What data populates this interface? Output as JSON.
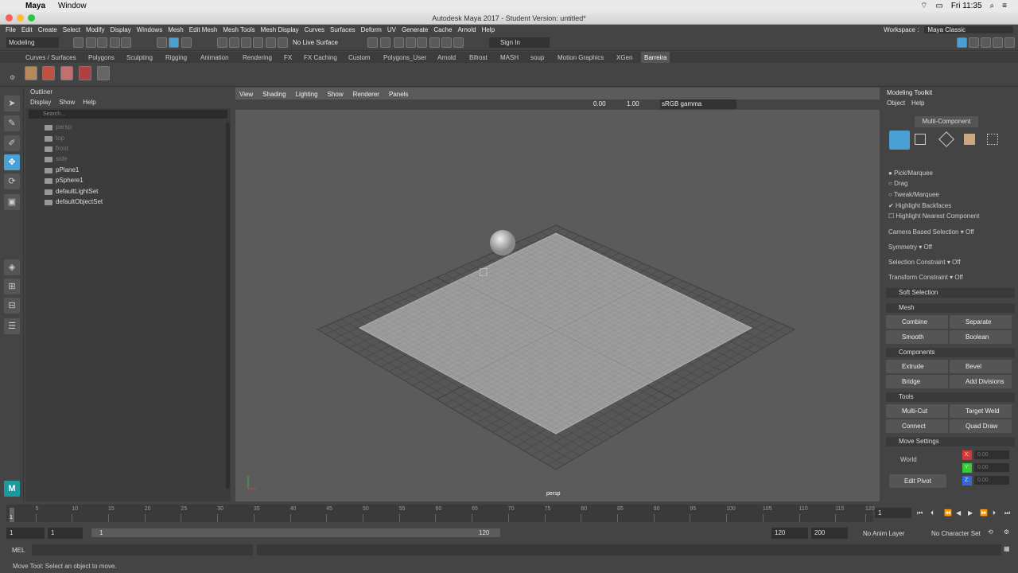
{
  "mac": {
    "apple": "",
    "app": "Maya",
    "window": "Window",
    "time": "Fri 11:35"
  },
  "title": "Autodesk Maya 2017 - Student Version: untitled*",
  "menus": [
    "File",
    "Edit",
    "Create",
    "Select",
    "Modify",
    "Display",
    "Windows",
    "Mesh",
    "Edit Mesh",
    "Mesh Tools",
    "Mesh Display",
    "Curves",
    "Surfaces",
    "Deform",
    "UV",
    "Generate",
    "Cache",
    "Arnold",
    "Help"
  ],
  "workspace": {
    "label": "Workspace :",
    "value": "Maya Classic"
  },
  "status": {
    "mode": "Modeling",
    "live": "No Live Surface",
    "signin": "Sign In"
  },
  "shelf_tabs": [
    "Curves / Surfaces",
    "Polygons",
    "Sculpting",
    "Rigging",
    "Animation",
    "Rendering",
    "FX",
    "FX Caching",
    "Custom",
    "Polygons_User",
    "Arnold",
    "Bifrost",
    "MASH",
    "soup",
    "Motion Graphics",
    "XGen",
    "Barreira"
  ],
  "outliner": {
    "title": "Outliner",
    "menu": [
      "Display",
      "Show",
      "Help"
    ],
    "search": "Search...",
    "items": [
      "persp",
      "top",
      "front",
      "side",
      "pPlane1",
      "pSphere1",
      "defaultLightSet",
      "defaultObjectSet"
    ]
  },
  "viewport": {
    "menu": [
      "View",
      "Shading",
      "Lighting",
      "Show",
      "Renderer",
      "Panels"
    ],
    "val1": "0.00",
    "val2": "1.00",
    "colorspace": "sRGB gamma",
    "camera": "persp"
  },
  "toolkit": {
    "title": "Modeling Toolkit",
    "menu": [
      "Object",
      "Help"
    ],
    "mode": "Multi-Component",
    "sel": [
      "Pick/Marquee",
      "Drag",
      "Tweak/Marquee"
    ],
    "checks": [
      "Highlight Backfaces",
      "Highlight Nearest Component"
    ],
    "props": [
      {
        "label": "Camera Based Selection",
        "value": "Off"
      },
      {
        "label": "Symmetry",
        "value": "Off"
      },
      {
        "label": "Selection Constraint",
        "value": "Off"
      },
      {
        "label": "Transform Constraint",
        "value": "Off"
      }
    ],
    "soft": "Soft Selection",
    "mesh": "Mesh",
    "mesh_btns": [
      "Combine",
      "Separate",
      "Smooth",
      "Boolean"
    ],
    "components": "Components",
    "comp_btns": [
      "Extrude",
      "Bevel",
      "Bridge",
      "Add Divisions"
    ],
    "tools": "Tools",
    "tool_btns": [
      "Multi-Cut",
      "Target Weld",
      "Connect",
      "Quad Draw"
    ],
    "move": "Move Settings",
    "world": "World",
    "pivot": "Edit Pivot",
    "axes": [
      "X:",
      "Y:",
      "Z:"
    ],
    "zero": "0.00"
  },
  "time": {
    "ticks": [
      "1",
      "5",
      "10",
      "15",
      "20",
      "25",
      "30",
      "35",
      "40",
      "45",
      "50",
      "55",
      "60",
      "65",
      "70",
      "75",
      "80",
      "85",
      "90",
      "95",
      "100",
      "105",
      "110",
      "115",
      "120"
    ],
    "current": "1"
  },
  "range": {
    "start": "1",
    "start2": "1",
    "inner_start": "1",
    "inner_end": "120",
    "end": "120",
    "end2": "200",
    "anim_layer": "No Anim Layer",
    "char_set": "No Character Set"
  },
  "cmd": {
    "label": "MEL"
  },
  "help": "Move Tool: Select an object to move.",
  "colors": {
    "viewport": "#5b5b5b",
    "grid": "#808080",
    "panel": "#444444",
    "accent": "#4a9fd4"
  }
}
